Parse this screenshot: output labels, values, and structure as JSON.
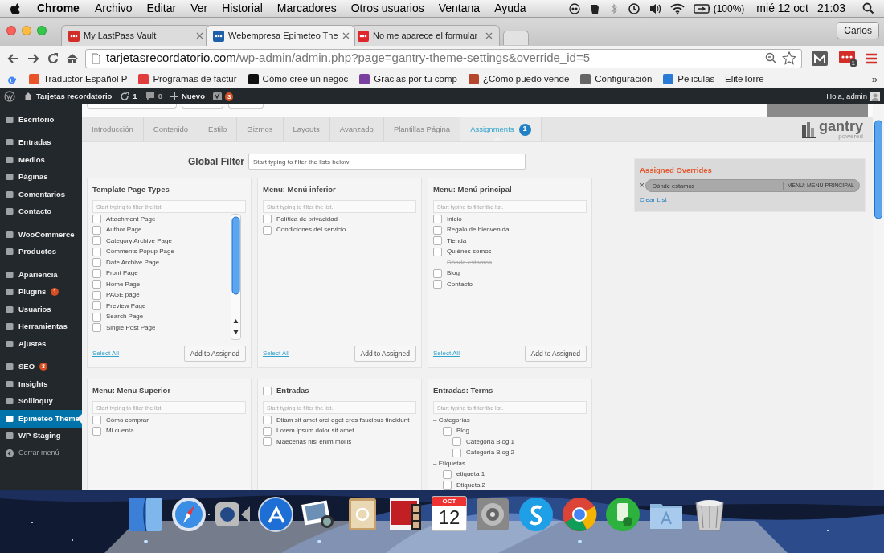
{
  "menubar": {
    "app": "Chrome",
    "menus": [
      "Archivo",
      "Editar",
      "Ver",
      "Historial",
      "Marcadores",
      "Otros usuarios",
      "Ventana",
      "Ayuda"
    ],
    "battery": "(100%)",
    "date": "mié 12 oct",
    "time": "21:03"
  },
  "browser_tabs": [
    {
      "title": "My LastPass Vault",
      "selected": false,
      "color": "#d32d27"
    },
    {
      "title": "Webempresa Epimeteo The",
      "selected": true,
      "color": "#1d5fa8"
    },
    {
      "title": "No me aparece el formular",
      "selected": false,
      "color": "#e0262c"
    }
  ],
  "profile": "Carlos",
  "address_bar": {
    "host": "tarjetasrecordatorio.com",
    "path": "/wp-admin/admin.php?page=gantry-theme-settings&override_id=5"
  },
  "extension_badge": "1",
  "bookmarks": [
    {
      "label": "Traductor Español P",
      "color": "#e8542a"
    },
    {
      "label": "Programas de factur",
      "color": "#e23b3b"
    },
    {
      "label": "Cómo creé un negoc",
      "color": "#111111"
    },
    {
      "label": "Gracias por tu comp",
      "color": "#7b3fa0"
    },
    {
      "label": "¿Cómo puedo vende",
      "color": "#b5452b"
    },
    {
      "label": "Configuración",
      "color": "#666666"
    },
    {
      "label": "Peliculas – EliteTorre",
      "color": "#2a7bd6"
    }
  ],
  "bookmarks_more": "»",
  "admin_bar": {
    "site": "Tarjetas recordatorio",
    "updates": "1",
    "comments": "0",
    "new": "Nuevo",
    "seo_badge": "3",
    "greeting": "Hola, admin"
  },
  "sidebar": {
    "groups": [
      [
        {
          "label": "Escritorio",
          "selected": false
        }
      ],
      [
        {
          "label": "Entradas",
          "selected": false
        },
        {
          "label": "Medios",
          "selected": false
        },
        {
          "label": "Páginas",
          "selected": false
        },
        {
          "label": "Comentarios",
          "selected": false
        },
        {
          "label": "Contacto",
          "selected": false
        }
      ],
      [
        {
          "label": "WooCommerce",
          "selected": false
        },
        {
          "label": "Productos",
          "selected": false
        }
      ],
      [
        {
          "label": "Apariencia",
          "selected": false
        },
        {
          "label": "Plugins",
          "selected": false,
          "badge": "1"
        },
        {
          "label": "Usuarios",
          "selected": false
        },
        {
          "label": "Herramientas",
          "selected": false
        },
        {
          "label": "Ajustes",
          "selected": false
        }
      ],
      [
        {
          "label": "SEO",
          "selected": false,
          "badge": "3"
        },
        {
          "label": "Insights",
          "selected": false
        },
        {
          "label": "Soliloquy",
          "selected": false
        },
        {
          "label": "Epimeteo Theme",
          "selected": true
        },
        {
          "label": "WP Staging",
          "selected": false
        },
        {
          "label": "Cerrar menú",
          "selected": false,
          "kind": "collapse"
        }
      ]
    ]
  },
  "theme_tabs": [
    {
      "label": "Introducción",
      "selected": false
    },
    {
      "label": "Contenido",
      "selected": false
    },
    {
      "label": "Estilo",
      "selected": false
    },
    {
      "label": "Gizmos",
      "selected": false
    },
    {
      "label": "Layouts",
      "selected": false
    },
    {
      "label": "Avanzado",
      "selected": false
    },
    {
      "label": "Plantillas Página",
      "selected": false
    },
    {
      "label": "Assignments",
      "selected": true,
      "badge": "1"
    }
  ],
  "logo": {
    "name": "gantry",
    "tagline": "powered"
  },
  "global_filter": {
    "label": "Global Filter",
    "placeholder": "Start typing to filter the lists below"
  },
  "panels": [
    {
      "title": "Template Page Types",
      "kind": "scroll-list",
      "placeholder": "Start typing to filter the list.",
      "items": [
        {
          "kind": "checkbox",
          "label": "Attachment Page",
          "checked": false
        },
        {
          "kind": "checkbox",
          "label": "Author Page",
          "checked": false
        },
        {
          "kind": "checkbox",
          "label": "Category Archive Page",
          "checked": false
        },
        {
          "kind": "checkbox",
          "label": "Comments Popup Page",
          "checked": false
        },
        {
          "kind": "checkbox",
          "label": "Date Archive Page",
          "checked": false
        },
        {
          "kind": "checkbox",
          "label": "Front Page",
          "checked": false
        },
        {
          "kind": "checkbox",
          "label": "Home Page",
          "checked": false
        },
        {
          "kind": "checkbox",
          "label": "PAGE page",
          "checked": false
        },
        {
          "kind": "checkbox",
          "label": "Preview Page",
          "checked": false
        },
        {
          "kind": "checkbox",
          "label": "Search Page",
          "checked": false
        },
        {
          "kind": "checkbox",
          "label": "Single Post Page",
          "checked": false
        }
      ],
      "select_all": "Select All",
      "add_button": "Add to Assigned"
    },
    {
      "title": "Menu: Menú inferior",
      "kind": "list",
      "placeholder": "Start typing to filter the list.",
      "items": [
        {
          "kind": "checkbox",
          "label": "Política de privacidad",
          "checked": false
        },
        {
          "kind": "checkbox",
          "label": "Condiciones del servicio",
          "checked": false
        }
      ],
      "select_all": "Select All",
      "add_button": "Add to Assigned"
    },
    {
      "title": "Menu: Menú principal",
      "kind": "list",
      "placeholder": "Start typing to filter the list.",
      "items": [
        {
          "kind": "checkbox",
          "label": "Inicio",
          "checked": false
        },
        {
          "kind": "checkbox",
          "label": "Regalo de bienvenida",
          "checked": false
        },
        {
          "kind": "checkbox",
          "label": "Tienda",
          "checked": false
        },
        {
          "kind": "checkbox",
          "label": "Quiénes somos",
          "checked": false
        },
        {
          "kind": "assigned",
          "label": "Dónde estamos"
        },
        {
          "kind": "checkbox",
          "label": "Blog",
          "checked": false
        },
        {
          "kind": "checkbox",
          "label": "Contacto",
          "checked": false
        }
      ],
      "select_all": "Select All",
      "add_button": "Add to Assigned"
    },
    {
      "title": "Menu: Menu Superior",
      "kind": "list",
      "placeholder": "Start typing to filter the list.",
      "items": [
        {
          "kind": "checkbox",
          "label": "Cómo comprar",
          "checked": false
        },
        {
          "kind": "checkbox",
          "label": "Mi cuenta",
          "checked": false
        }
      ]
    },
    {
      "title": "Entradas",
      "kind": "list",
      "title_checkbox": {
        "checked": false
      },
      "placeholder": "Start typing to filter the list.",
      "items": [
        {
          "kind": "checkbox",
          "label": "Etiam sit amet orci eget eros faucibus tincidunt",
          "checked": false
        },
        {
          "kind": "checkbox",
          "label": "Lorem ipsum dolor sit amet",
          "checked": false
        },
        {
          "kind": "checkbox",
          "label": "Maecenas nisi enim mollis",
          "checked": false
        }
      ]
    },
    {
      "title": "Entradas: Terms",
      "kind": "list",
      "placeholder": "Start typing to filter the list.",
      "items": [
        {
          "kind": "group",
          "label": "– Categorías",
          "children": [
            {
              "kind": "checkbox",
              "label": "Blog",
              "checked": false,
              "children": [
                {
                  "kind": "checkbox",
                  "label": "Categoría Blog 1",
                  "checked": false
                },
                {
                  "kind": "checkbox",
                  "label": "Categoría Blog 2",
                  "checked": false
                }
              ]
            }
          ]
        },
        {
          "kind": "group",
          "label": "– Etiquetas",
          "children": [
            {
              "kind": "checkbox",
              "label": "etiqueta 1",
              "checked": false
            },
            {
              "kind": "checkbox",
              "label": "Etiqueta 2",
              "checked": false
            }
          ]
        }
      ]
    }
  ],
  "assigned_overrides": {
    "title": "Assigned Overrides",
    "remove": "×",
    "items": [
      {
        "label": "Dónde estamos",
        "source": "MENU: MENÚ PRINCIPAL"
      }
    ],
    "clear": "Clear List"
  },
  "dock": [
    {
      "kind": "finder",
      "running": true
    },
    {
      "kind": "compass",
      "running": false
    },
    {
      "kind": "camera",
      "running": false
    },
    {
      "kind": "appstore",
      "running": false
    },
    {
      "kind": "photos",
      "running": true
    },
    {
      "kind": "addressbook",
      "running": false
    },
    {
      "kind": "curtain",
      "running": false
    },
    {
      "kind": "calendar",
      "month": "OCT",
      "day": "12",
      "running": false
    },
    {
      "kind": "gear",
      "running": false
    },
    {
      "kind": "chat",
      "running": false
    },
    {
      "kind": "browser",
      "running": true
    },
    {
      "kind": "sync",
      "running": false
    },
    {
      "kind": "folder",
      "running": false
    },
    {
      "kind": "trash",
      "running": false
    }
  ]
}
